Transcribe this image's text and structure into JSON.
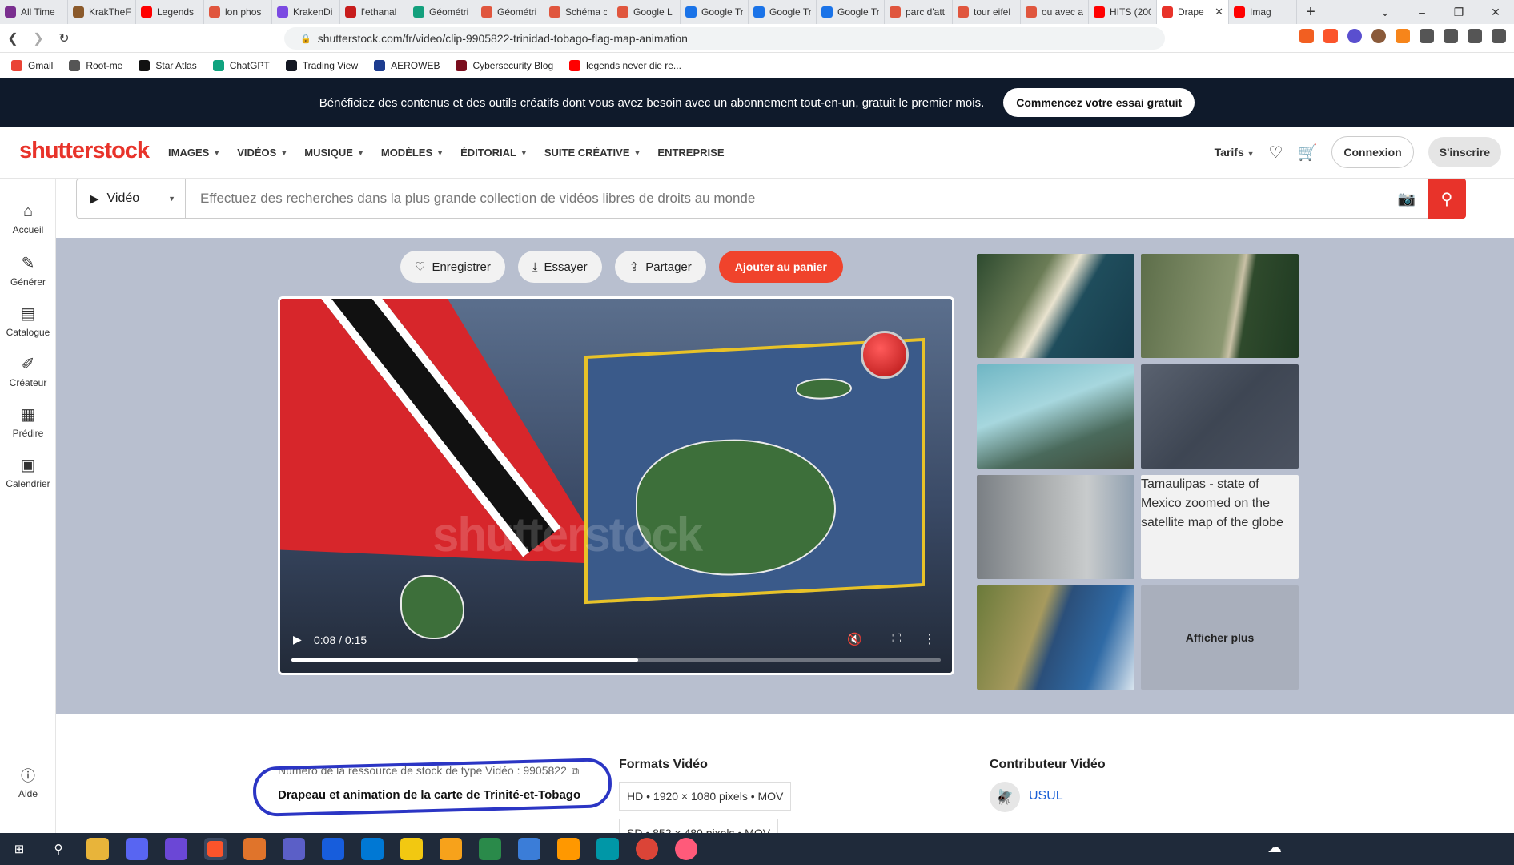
{
  "browser": {
    "tabs": [
      {
        "label": "All Time",
        "color": "#7a2f8f"
      },
      {
        "label": "KrakTheF",
        "color": "#8b5a2b"
      },
      {
        "label": "Legends",
        "color": "#ff0000"
      },
      {
        "label": "lon phos",
        "color": "#e0563e"
      },
      {
        "label": "KrakenDi",
        "color": "#7b4ae2"
      },
      {
        "label": "l'ethanal",
        "color": "#c71c1c"
      },
      {
        "label": "Géométri",
        "color": "#13a07d"
      },
      {
        "label": "Géométri",
        "color": "#e0563e"
      },
      {
        "label": "Schéma c",
        "color": "#e0563e"
      },
      {
        "label": "Google L",
        "color": "#e0563e"
      },
      {
        "label": "Google Tr",
        "color": "#1a73e8"
      },
      {
        "label": "Google Tr",
        "color": "#1a73e8"
      },
      {
        "label": "Google Tr",
        "color": "#1a73e8"
      },
      {
        "label": "parc d'att",
        "color": "#e0563e"
      },
      {
        "label": "tour eifel",
        "color": "#e0563e"
      },
      {
        "label": "ou avec a",
        "color": "#e0563e"
      },
      {
        "label": "HITS (200",
        "color": "#ff0000"
      },
      {
        "label": "Drape",
        "color": "#e8332a",
        "active": true
      },
      {
        "label": "Imag",
        "color": "#ff0000"
      }
    ],
    "new_tab": "+",
    "url": "shutterstock.com/fr/video/clip-9905822-trinidad-tobago-flag-map-animation",
    "bookmarks": [
      {
        "label": "Gmail",
        "color": "#ea4335"
      },
      {
        "label": "Root-me",
        "color": "#555555"
      },
      {
        "label": "Star Atlas",
        "color": "#111111"
      },
      {
        "label": "ChatGPT",
        "color": "#10a37f"
      },
      {
        "label": "Trading View",
        "color": "#131722"
      },
      {
        "label": "AEROWEB",
        "color": "#1d3c8f"
      },
      {
        "label": "Cybersecurity Blog",
        "color": "#7a0d1d"
      },
      {
        "label": "legends never die re...",
        "color": "#ff0000"
      }
    ]
  },
  "promo": {
    "text": "Bénéficiez des contenus et des outils créatifs dont vous avez besoin avec un abonnement tout-en-un, gratuit le premier mois.",
    "cta": "Commencez votre essai gratuit"
  },
  "header": {
    "logo": "shutterstock",
    "nav": [
      "IMAGES",
      "VIDÉOS",
      "MUSIQUE",
      "MODÈLES",
      "ÉDITORIAL",
      "SUITE CRÉATIVE",
      "ENTREPRISE"
    ],
    "tarifs": "Tarifs",
    "login": "Connexion",
    "signup": "S'inscrire"
  },
  "rail": [
    {
      "label": "Accueil",
      "icon": "home-icon",
      "glyph": "⌂"
    },
    {
      "label": "Générer",
      "icon": "generate-icon",
      "glyph": "✎"
    },
    {
      "label": "Catalogue",
      "icon": "catalog-icon",
      "glyph": "▤"
    },
    {
      "label": "Créateur",
      "icon": "creator-icon",
      "glyph": "✐"
    },
    {
      "label": "Prédire",
      "icon": "predict-icon",
      "glyph": "▦"
    },
    {
      "label": "Calendrier",
      "icon": "calendar-icon",
      "glyph": "▣"
    }
  ],
  "help": "Aide",
  "search": {
    "media_type": "Vidéo",
    "placeholder": "Effectuez des recherches dans la plus grande collection de vidéos libres de droits au monde"
  },
  "actions": {
    "save": "Enregistrer",
    "try": "Essayer",
    "share": "Partager",
    "add_to_cart": "Ajouter au panier"
  },
  "player": {
    "time": "0:08 / 0:15",
    "progress_fraction": 0.5333,
    "watermark": "shutterstock"
  },
  "related": {
    "alt_text": "Tamaulipas - state of Mexico zoomed on the satellite map of the globe",
    "show_more": "Afficher plus"
  },
  "details": {
    "stock_id": "Numéro de la ressource de stock de type Vidéo : 9905822",
    "title": "Drapeau et animation de la carte de Trinité-et-Tobago",
    "formats_heading": "Formats Vidéo",
    "formats": [
      "HD • 1920 × 1080 pixels • MOV",
      "SD • 852 × 480 pixels • MOV"
    ],
    "contributor_heading": "Contributeur Vidéo",
    "contributor_name": "USUL"
  },
  "colors": {
    "brand_red": "#e8332a",
    "promo_bg": "#0f1a2b",
    "annotation": "#2b35c4"
  }
}
